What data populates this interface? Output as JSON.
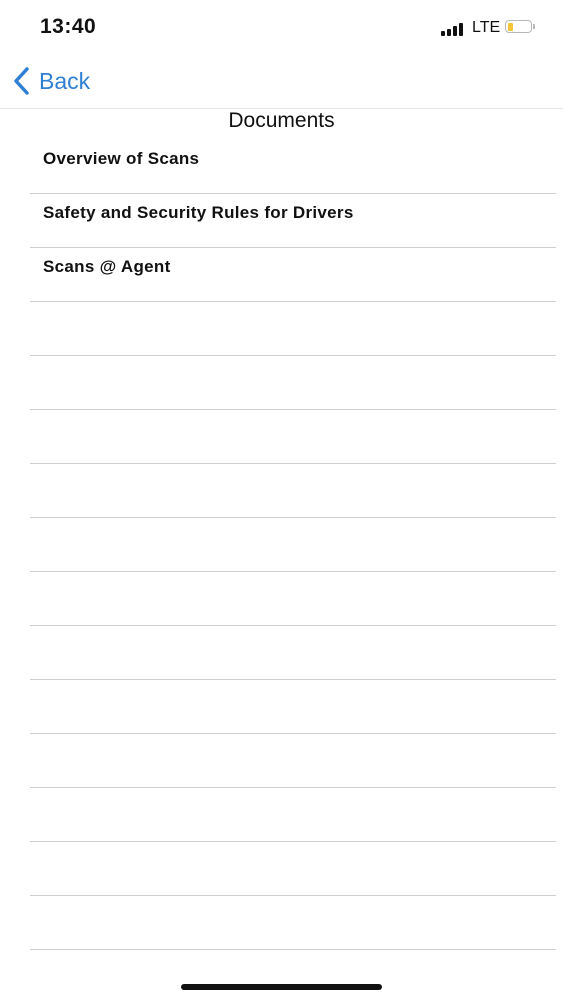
{
  "status_bar": {
    "time": "13:40",
    "network": "LTE",
    "signal_icon": "cellular-signal-icon",
    "battery_icon": "battery-low-icon",
    "battery_color": "#f2c437"
  },
  "nav": {
    "back_label": "Back",
    "back_icon": "chevron-left-icon",
    "accent_color": "#2f7fd3"
  },
  "page": {
    "title": "Documents"
  },
  "documents": {
    "items": [
      {
        "label": "Overview of Scans"
      },
      {
        "label": "Safety and Security Rules for Drivers"
      },
      {
        "label": "Scans @ Agent"
      },
      {
        "label": ""
      },
      {
        "label": ""
      },
      {
        "label": ""
      },
      {
        "label": ""
      },
      {
        "label": ""
      },
      {
        "label": ""
      },
      {
        "label": ""
      },
      {
        "label": ""
      },
      {
        "label": ""
      },
      {
        "label": ""
      },
      {
        "label": ""
      },
      {
        "label": ""
      }
    ]
  }
}
